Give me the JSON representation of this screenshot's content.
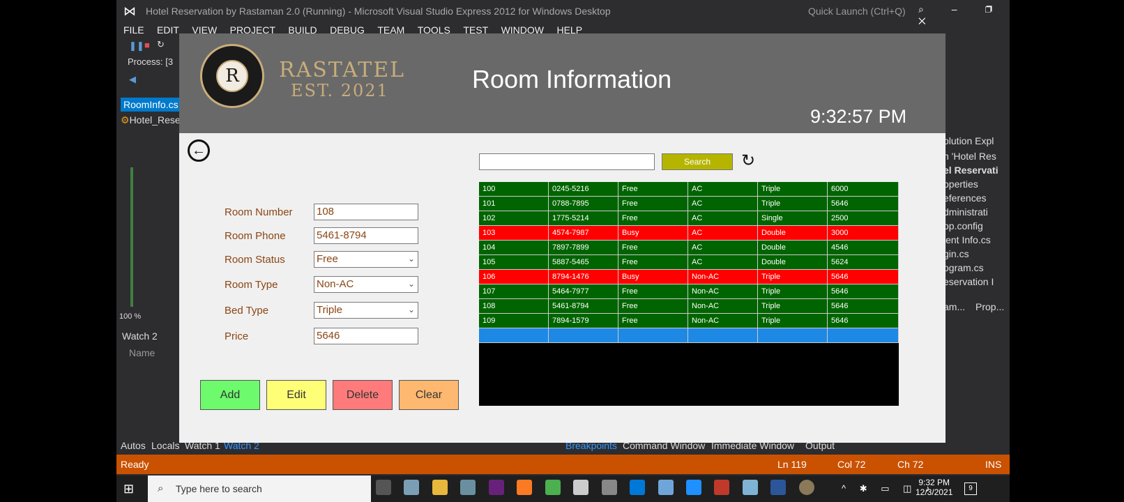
{
  "vs": {
    "title": "Hotel Reservation by Rastaman 2.0 (Running) - Microsoft Visual Studio Express 2012 for Windows Desktop",
    "quick_launch": "Quick Launch (Ctrl+Q)",
    "menu": [
      "FILE",
      "EDIT",
      "VIEW",
      "PROJECT",
      "BUILD",
      "DEBUG",
      "TEAM",
      "TOOLS",
      "TEST",
      "WINDOW",
      "HELP"
    ],
    "process_label": "Process:",
    "process_value": "[3",
    "active_tab": "RoomInfo.cs",
    "nav_item": "Hotel_Rese",
    "zoom": "100 %",
    "watch_title": "Watch 2",
    "watch_col": "Name",
    "solution_explorer": [
      "olution Expl",
      "n 'Hotel Res",
      "el Reservati",
      "operties",
      "eferences",
      "dministrati",
      "op.config",
      "ient Info.cs",
      "gin.cs",
      "ogram.cs",
      "eservation I"
    ],
    "panel_tabs": [
      "am...",
      "Prop..."
    ],
    "bottom_left_tabs": [
      "Autos",
      "Locals",
      "Watch 1",
      "Watch 2"
    ],
    "bottom_right_tabs": [
      "Breakpoints",
      "Command Window",
      "Immediate Window",
      "Output"
    ],
    "status": {
      "ready": "Ready",
      "ln": "Ln 119",
      "col": "Col 72",
      "ch": "Ch 72",
      "ins": "INS"
    }
  },
  "taskbar": {
    "search_placeholder": "Type here to search",
    "time": "9:32 PM",
    "date": "12/3/2021",
    "notifications": "9"
  },
  "app": {
    "brand_name": "RASTATEL",
    "brand_est": "EST. 2021",
    "logo_letter": "R",
    "title": "Room Information",
    "clock": "9:32:57 PM",
    "form": {
      "room_number_label": "Room Number",
      "room_number_value": "108",
      "room_phone_label": "Room Phone",
      "room_phone_value": "5461-8794",
      "room_status_label": "Room Status",
      "room_status_value": "Free",
      "room_type_label": "Room Type",
      "room_type_value": "Non-AC",
      "bed_type_label": "Bed Type",
      "bed_type_value": "Triple",
      "price_label": "Price",
      "price_value": "5646"
    },
    "buttons": {
      "add": "Add",
      "edit": "Edit",
      "delete": "Delete",
      "clear": "Clear"
    },
    "search_button": "Search",
    "rows": [
      [
        "100",
        "0245-5216",
        "Free",
        "AC",
        "Triple",
        "6000"
      ],
      [
        "101",
        "0788-7895",
        "Free",
        "AC",
        "Triple",
        "5646"
      ],
      [
        "102",
        "1775-5214",
        "Free",
        "AC",
        "Single",
        "2500"
      ],
      [
        "103",
        "4574-7987",
        "Busy",
        "AC",
        "Double",
        "3000"
      ],
      [
        "104",
        "7897-7899",
        "Free",
        "AC",
        "Double",
        "4546"
      ],
      [
        "105",
        "5887-5465",
        "Free",
        "AC",
        "Double",
        "5624"
      ],
      [
        "106",
        "8794-1476",
        "Busy",
        "Non-AC",
        "Triple",
        "5646"
      ],
      [
        "107",
        "5464-7977",
        "Free",
        "Non-AC",
        "Triple",
        "5646"
      ],
      [
        "108",
        "5461-8794",
        "Free",
        "Non-AC",
        "Triple",
        "5646"
      ],
      [
        "109",
        "7894-1579",
        "Free",
        "Non-AC",
        "Triple",
        "5646"
      ]
    ],
    "colors": {
      "free": "#006400",
      "busy": "#ff0000",
      "selected": "#1e88e5"
    }
  }
}
